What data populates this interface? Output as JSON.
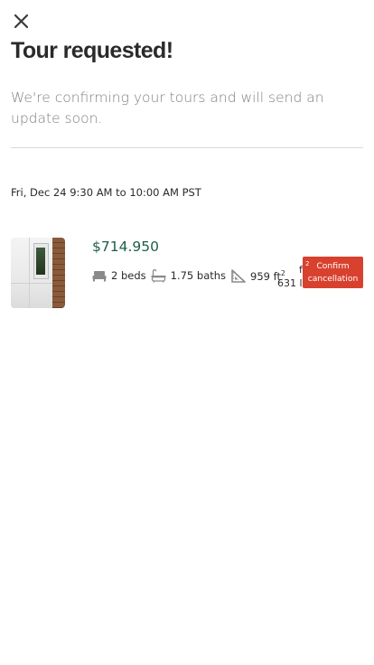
{
  "header": {
    "close_icon": "close-icon",
    "title": "Tour requested!",
    "subtitle": "We're confirming your tours and will send an update soon."
  },
  "tour": {
    "date_time": "Fri, Dec 24 9:30 AM to 10:00 AM PST"
  },
  "listing": {
    "price": "$714.950",
    "beds": "2 beds",
    "baths": "1.75 baths",
    "sqft_value": "959 ft",
    "sqft_sup": "2",
    "overflow_fragment_1": "f",
    "overflow_fragment_2": "631 l",
    "confirm_sup": "2",
    "confirm_line1": "Confirm",
    "confirm_line2": "cancellation"
  },
  "colors": {
    "price": "#1c5e4a",
    "confirm_button": "#d9412f",
    "subtitle": "#808080"
  }
}
